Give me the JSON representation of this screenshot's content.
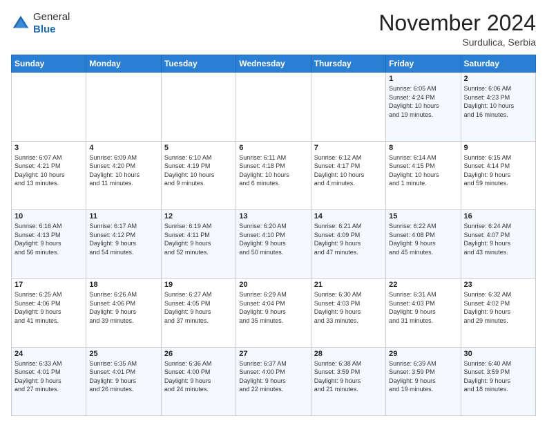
{
  "header": {
    "logo_line1": "General",
    "logo_line2": "Blue",
    "month_title": "November 2024",
    "location": "Surdulica, Serbia"
  },
  "weekdays": [
    "Sunday",
    "Monday",
    "Tuesday",
    "Wednesday",
    "Thursday",
    "Friday",
    "Saturday"
  ],
  "weeks": [
    [
      {
        "day": "",
        "info": ""
      },
      {
        "day": "",
        "info": ""
      },
      {
        "day": "",
        "info": ""
      },
      {
        "day": "",
        "info": ""
      },
      {
        "day": "",
        "info": ""
      },
      {
        "day": "1",
        "info": "Sunrise: 6:05 AM\nSunset: 4:24 PM\nDaylight: 10 hours\nand 19 minutes."
      },
      {
        "day": "2",
        "info": "Sunrise: 6:06 AM\nSunset: 4:23 PM\nDaylight: 10 hours\nand 16 minutes."
      }
    ],
    [
      {
        "day": "3",
        "info": "Sunrise: 6:07 AM\nSunset: 4:21 PM\nDaylight: 10 hours\nand 13 minutes."
      },
      {
        "day": "4",
        "info": "Sunrise: 6:09 AM\nSunset: 4:20 PM\nDaylight: 10 hours\nand 11 minutes."
      },
      {
        "day": "5",
        "info": "Sunrise: 6:10 AM\nSunset: 4:19 PM\nDaylight: 10 hours\nand 9 minutes."
      },
      {
        "day": "6",
        "info": "Sunrise: 6:11 AM\nSunset: 4:18 PM\nDaylight: 10 hours\nand 6 minutes."
      },
      {
        "day": "7",
        "info": "Sunrise: 6:12 AM\nSunset: 4:17 PM\nDaylight: 10 hours\nand 4 minutes."
      },
      {
        "day": "8",
        "info": "Sunrise: 6:14 AM\nSunset: 4:15 PM\nDaylight: 10 hours\nand 1 minute."
      },
      {
        "day": "9",
        "info": "Sunrise: 6:15 AM\nSunset: 4:14 PM\nDaylight: 9 hours\nand 59 minutes."
      }
    ],
    [
      {
        "day": "10",
        "info": "Sunrise: 6:16 AM\nSunset: 4:13 PM\nDaylight: 9 hours\nand 56 minutes."
      },
      {
        "day": "11",
        "info": "Sunrise: 6:17 AM\nSunset: 4:12 PM\nDaylight: 9 hours\nand 54 minutes."
      },
      {
        "day": "12",
        "info": "Sunrise: 6:19 AM\nSunset: 4:11 PM\nDaylight: 9 hours\nand 52 minutes."
      },
      {
        "day": "13",
        "info": "Sunrise: 6:20 AM\nSunset: 4:10 PM\nDaylight: 9 hours\nand 50 minutes."
      },
      {
        "day": "14",
        "info": "Sunrise: 6:21 AM\nSunset: 4:09 PM\nDaylight: 9 hours\nand 47 minutes."
      },
      {
        "day": "15",
        "info": "Sunrise: 6:22 AM\nSunset: 4:08 PM\nDaylight: 9 hours\nand 45 minutes."
      },
      {
        "day": "16",
        "info": "Sunrise: 6:24 AM\nSunset: 4:07 PM\nDaylight: 9 hours\nand 43 minutes."
      }
    ],
    [
      {
        "day": "17",
        "info": "Sunrise: 6:25 AM\nSunset: 4:06 PM\nDaylight: 9 hours\nand 41 minutes."
      },
      {
        "day": "18",
        "info": "Sunrise: 6:26 AM\nSunset: 4:06 PM\nDaylight: 9 hours\nand 39 minutes."
      },
      {
        "day": "19",
        "info": "Sunrise: 6:27 AM\nSunset: 4:05 PM\nDaylight: 9 hours\nand 37 minutes."
      },
      {
        "day": "20",
        "info": "Sunrise: 6:29 AM\nSunset: 4:04 PM\nDaylight: 9 hours\nand 35 minutes."
      },
      {
        "day": "21",
        "info": "Sunrise: 6:30 AM\nSunset: 4:03 PM\nDaylight: 9 hours\nand 33 minutes."
      },
      {
        "day": "22",
        "info": "Sunrise: 6:31 AM\nSunset: 4:03 PM\nDaylight: 9 hours\nand 31 minutes."
      },
      {
        "day": "23",
        "info": "Sunrise: 6:32 AM\nSunset: 4:02 PM\nDaylight: 9 hours\nand 29 minutes."
      }
    ],
    [
      {
        "day": "24",
        "info": "Sunrise: 6:33 AM\nSunset: 4:01 PM\nDaylight: 9 hours\nand 27 minutes."
      },
      {
        "day": "25",
        "info": "Sunrise: 6:35 AM\nSunset: 4:01 PM\nDaylight: 9 hours\nand 26 minutes."
      },
      {
        "day": "26",
        "info": "Sunrise: 6:36 AM\nSunset: 4:00 PM\nDaylight: 9 hours\nand 24 minutes."
      },
      {
        "day": "27",
        "info": "Sunrise: 6:37 AM\nSunset: 4:00 PM\nDaylight: 9 hours\nand 22 minutes."
      },
      {
        "day": "28",
        "info": "Sunrise: 6:38 AM\nSunset: 3:59 PM\nDaylight: 9 hours\nand 21 minutes."
      },
      {
        "day": "29",
        "info": "Sunrise: 6:39 AM\nSunset: 3:59 PM\nDaylight: 9 hours\nand 19 minutes."
      },
      {
        "day": "30",
        "info": "Sunrise: 6:40 AM\nSunset: 3:59 PM\nDaylight: 9 hours\nand 18 minutes."
      }
    ]
  ]
}
